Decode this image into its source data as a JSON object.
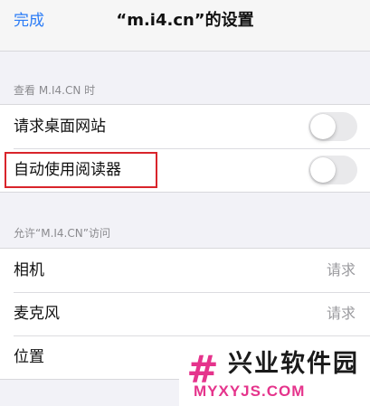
{
  "nav": {
    "done_label": "完成",
    "title": "“m.i4.cn”的设置"
  },
  "section_view": {
    "header": "查看 M.I4.CN 时",
    "rows": [
      {
        "label": "请求桌面网站",
        "toggle_on": false
      },
      {
        "label": "自动使用阅读器",
        "toggle_on": false
      }
    ]
  },
  "section_access": {
    "header": "允许“M.I4.CN”访问",
    "rows": [
      {
        "label": "相机",
        "value": "请求"
      },
      {
        "label": "麦克风",
        "value": "请求"
      },
      {
        "label": "位置",
        "value": ""
      }
    ]
  },
  "watermark": {
    "logo_glyph": "#",
    "name_cn": "兴业软件园",
    "name_en": "MYXYJS.COM"
  },
  "colors": {
    "accent": "#2b7cf6",
    "highlight": "#d9242b",
    "watermark": "#e5348c",
    "background": "#f2f2f7"
  }
}
